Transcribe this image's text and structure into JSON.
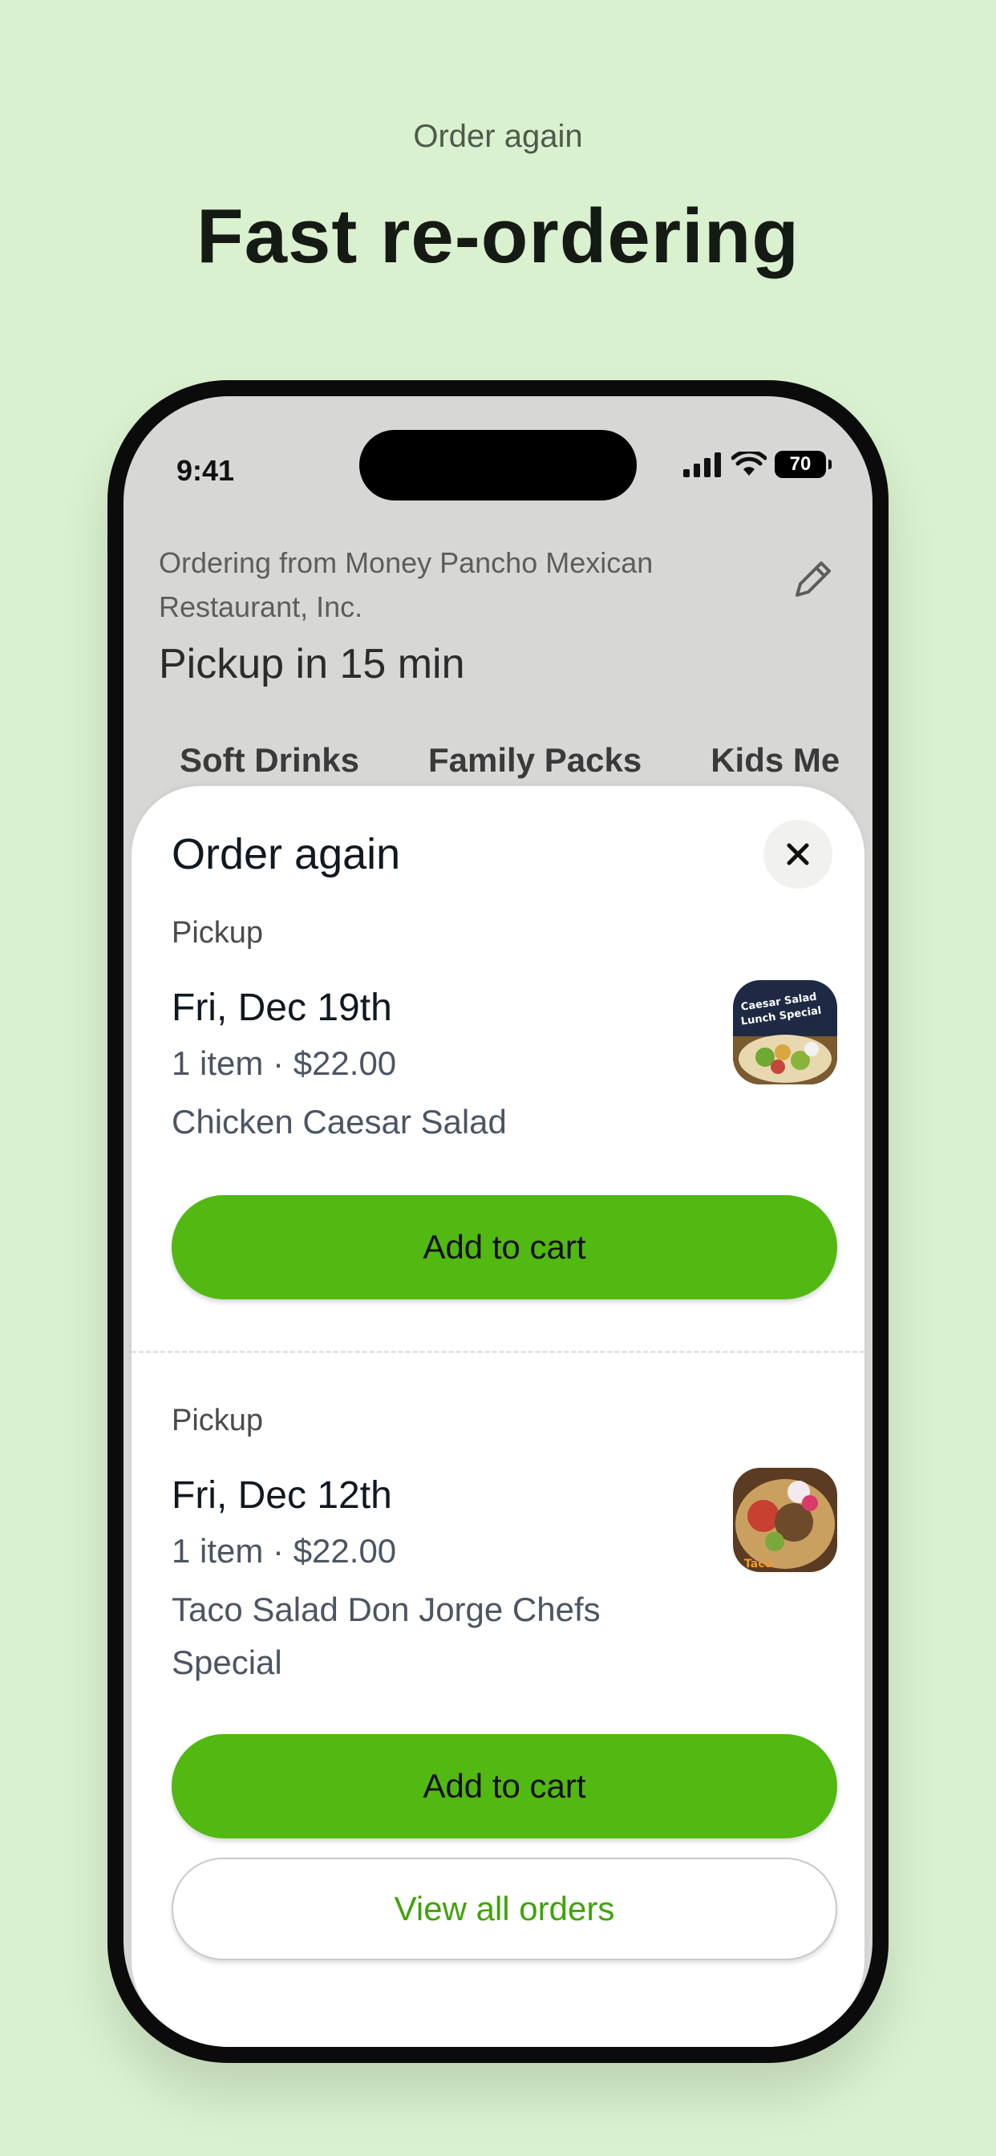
{
  "hero": {
    "eyebrow": "Order again",
    "title": "Fast re-ordering"
  },
  "status_bar": {
    "time": "9:41",
    "battery": "70",
    "icons": [
      "signal-icon",
      "wifi-icon",
      "battery-icon"
    ]
  },
  "restaurant_header": {
    "ordering_from": "Ordering from Money Pancho Mexican Restaurant, Inc.",
    "pickup_time": "Pickup in 15 min",
    "edit_icon": "pencil-icon"
  },
  "category_tabs": [
    "Soft Drinks",
    "Family Packs",
    "Kids Me"
  ],
  "sheet": {
    "title": "Order again",
    "close_icon": "close-icon",
    "orders": [
      {
        "type": "Pickup",
        "date": "Fri, Dec 19th",
        "meta": "1 item · $22.00",
        "items": "Chicken Caesar Salad",
        "thumb_caption": "Caesar Salad Lunch Special",
        "button": "Add to cart"
      },
      {
        "type": "Pickup",
        "date": "Fri, Dec 12th",
        "meta": "1 item · $22.00",
        "items": "Taco Salad Don Jorge Chefs Special",
        "thumb_caption": "Taco",
        "button": "Add to cart"
      }
    ],
    "view_all": "View all orders"
  },
  "colors": {
    "background": "#d9f1cf",
    "primary_button": "#52b812",
    "link_green": "#40a30b"
  }
}
